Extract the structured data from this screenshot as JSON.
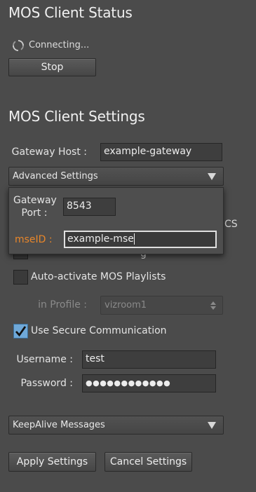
{
  "status": {
    "title": "MOS Client Status",
    "state_text": "Connecting...",
    "stop_label": "Stop"
  },
  "settings": {
    "title": "MOS Client Settings",
    "gateway_host_label": "Gateway Host :",
    "gateway_host_value": "example-gateway",
    "advanced_label": "Advanced Settings",
    "hidden_text_right": "CS",
    "hidden_text_left": "g",
    "auto_activate_label": "Auto-activate MOS Playlists",
    "in_profile_label": "in Profile :",
    "in_profile_value": "vizroom1",
    "secure_label": "Use Secure Communication",
    "secure_checked": true,
    "username_label": "Username :",
    "username_value": "test",
    "password_label": "Password :",
    "password_value": "●●●●●●●●●●●●",
    "keepalive_label": "KeepAlive Messages",
    "apply_label": "Apply Settings",
    "cancel_label": "Cancel Settings"
  },
  "advanced_popup": {
    "gateway_port_label_1": "Gateway",
    "gateway_port_label_2": "Port :",
    "gateway_port_value": "8543",
    "mse_id_label": "mseID :",
    "mse_id_value": "example-mse"
  },
  "colors": {
    "background": "#4b4b4b",
    "accent_orange": "#e8862a",
    "checkbox_blue": "#6fa8d8"
  },
  "icons": {
    "spinner": "refresh-spinner-icon",
    "dropdown": "triangle-down-icon",
    "checkmark": "checkmark-icon"
  }
}
